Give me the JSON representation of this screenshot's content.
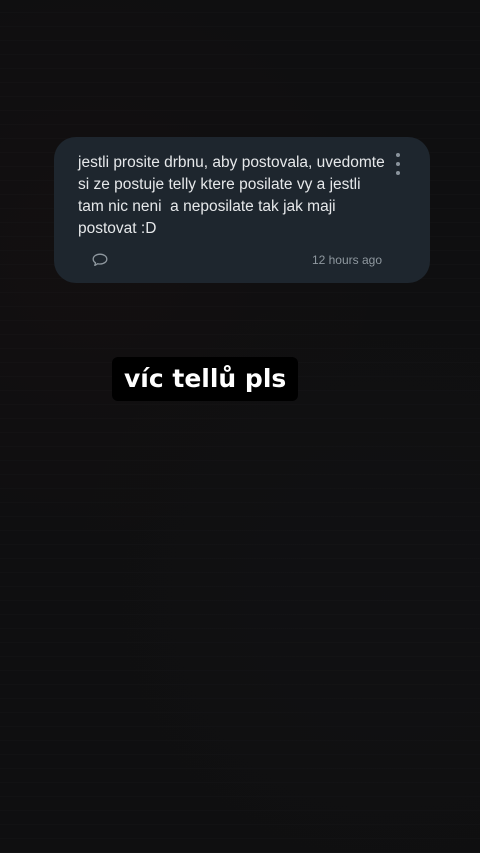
{
  "comment": {
    "text": "jestli prosite drbnu, aby postovala, uvedomte si ze postuje telly ktere posilate vy a jestli tam nic neni  a neposilate tak jak maji postovat :D",
    "timestamp": "12 hours ago",
    "reply_icon": "speech-bubble-icon",
    "more_icon": "vertical-dots-icon"
  },
  "caption": {
    "text": "víc tellů pls"
  },
  "colors": {
    "background": "#0f0f10",
    "card": "#1e262e",
    "text": "#e6e8ea",
    "muted": "#8f989f",
    "caption_bg": "#000000",
    "caption_text": "#ffffff"
  }
}
